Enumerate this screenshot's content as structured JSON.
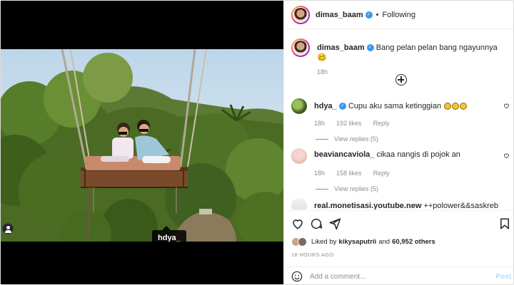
{
  "post": {
    "author": "dimas_baam",
    "follow_status": "Following",
    "separator": "•",
    "image_tag": "hdya_"
  },
  "caption": {
    "author": "dimas_baam",
    "text": "Bang pelan pelan bang ngayunnya 🥴",
    "time": "18h"
  },
  "comments": [
    {
      "author": "hdya_",
      "verified": true,
      "text": "Cupu aku sama ketinggian",
      "emoji_count": 3,
      "time": "18h",
      "likes": "192 likes",
      "reply_label": "Reply",
      "view_replies": "View replies (5)"
    },
    {
      "author": "beaviancaviola_",
      "verified": false,
      "text": "cikaa nangis di pojok an",
      "time": "18h",
      "likes": "158 likes",
      "reply_label": "Reply",
      "view_replies": "View replies (5)"
    },
    {
      "author": "real.monetisasi.youtube.new",
      "verified": false,
      "text": "++polower&&saskreb"
    }
  ],
  "likes_summary": {
    "prefix": "Liked by",
    "user": "kikysaputrii",
    "joiner": "and",
    "others": "60,952 others"
  },
  "posted_date": "18 HOURS AGO",
  "add_comment": {
    "placeholder": "Add a comment...",
    "post_label": "Post"
  },
  "icons": {
    "like": "heart-icon",
    "comment": "comment-bubble-icon",
    "share": "paper-plane-icon",
    "save": "bookmark-icon",
    "emoji": "smiley-face-icon",
    "load_more": "plus-circle-icon",
    "tagged_users": "user-tag-icon"
  },
  "colors": {
    "verified": "#3897f0",
    "muted": "#8e8e8e",
    "post_disabled": "#b2dffc"
  }
}
